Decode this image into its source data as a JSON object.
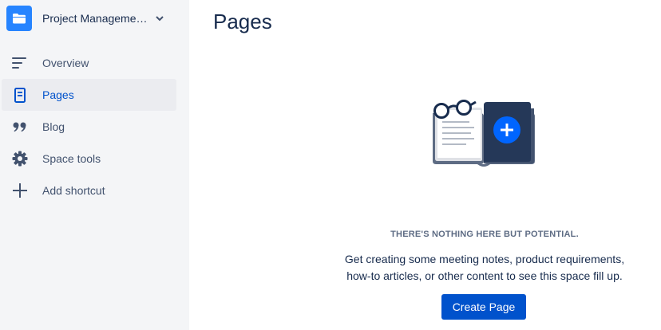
{
  "sidebar": {
    "space_name": "Project Manageme…",
    "space_icon": "folder-icon",
    "items": [
      {
        "label": "Overview",
        "icon": "overview-icon",
        "active": false
      },
      {
        "label": "Pages",
        "icon": "pages-icon",
        "active": true
      },
      {
        "label": "Blog",
        "icon": "quote-icon",
        "active": false
      },
      {
        "label": "Space tools",
        "icon": "gear-icon",
        "active": false
      },
      {
        "label": "Add shortcut",
        "icon": "plus-icon",
        "active": false
      }
    ]
  },
  "main": {
    "title": "Pages",
    "empty_state": {
      "heading": "THERE'S NOTHING HERE BUT POTENTIAL.",
      "body_line1": "Get creating some meeting notes, product requirements,",
      "body_line2": "how-to articles, or other content to see this space fill up.",
      "button_label": "Create Page"
    }
  },
  "colors": {
    "accent": "#0052cc",
    "avatar": "#2684ff",
    "sidebar_bg": "#f4f5f7",
    "active_bg": "#ebecf0"
  }
}
